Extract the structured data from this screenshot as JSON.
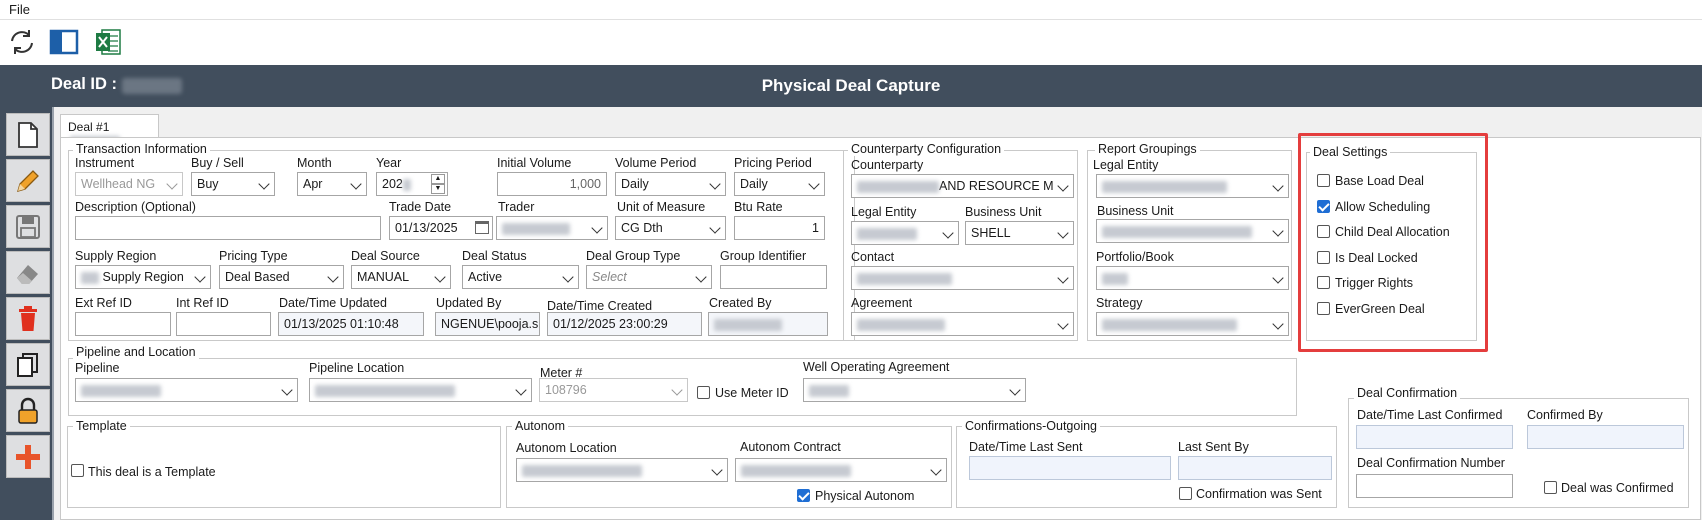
{
  "menu": {
    "file": "File"
  },
  "toolbar": {
    "icons": [
      "refresh-icon",
      "panel-layout-icon",
      "excel-icon"
    ]
  },
  "header": {
    "deal_id_label": "Deal ID :",
    "title": "Physical Deal Capture"
  },
  "sidebar": {
    "icons": [
      "new-document-icon",
      "edit-pencil-icon",
      "save-icon",
      "eraser-icon",
      "delete-trash-icon",
      "copy-icon",
      "lock-icon",
      "add-plus-icon"
    ]
  },
  "tab": {
    "label": "Deal #1"
  },
  "transaction": {
    "title": "Transaction Information",
    "instrument_label": "Instrument",
    "instrument_value": "Wellhead NG",
    "buysell_label": "Buy / Sell",
    "buysell_value": "Buy",
    "month_label": "Month",
    "month_value": "Apr",
    "year_label": "Year",
    "year_value": "202",
    "initial_volume_label": "Initial Volume",
    "initial_volume_value": "1,000",
    "volume_period_label": "Volume Period",
    "volume_period_value": "Daily",
    "pricing_period_label": "Pricing Period",
    "pricing_period_value": "Daily",
    "description_label": "Description (Optional)",
    "trade_date_label": "Trade Date",
    "trade_date_value": "01/13/2025",
    "trader_label": "Trader",
    "uom_label": "Unit of Measure",
    "uom_value": "CG Dth",
    "btu_label": "Btu Rate",
    "btu_value": "1",
    "supply_region_label": "Supply Region",
    "supply_region_value": "Supply Region",
    "pricing_type_label": "Pricing Type",
    "pricing_type_value": "Deal Based",
    "deal_source_label": "Deal Source",
    "deal_source_value": "MANUAL",
    "deal_status_label": "Deal Status",
    "deal_status_value": "Active",
    "deal_group_type_label": "Deal Group Type",
    "deal_group_type_placeholder": "Select",
    "group_identifier_label": "Group Identifier",
    "ext_ref_label": "Ext Ref ID",
    "int_ref_label": "Int Ref ID",
    "updated_dt_label": "Date/Time Updated",
    "updated_dt_value": "01/13/2025 01:10:48",
    "updated_by_label": "Updated By",
    "updated_by_value": "NGENUE\\pooja.s",
    "created_dt_label": "Date/Time Created",
    "created_dt_value": "01/12/2025 23:00:29",
    "created_by_label": "Created By"
  },
  "counterparty": {
    "title": "Counterparty Configuration",
    "counterparty_label": "Counterparty",
    "counterparty_value": "AND RESOURCE M",
    "legal_entity_label": "Legal Entity",
    "business_unit_label": "Business Unit",
    "business_unit_value": "SHELL",
    "contact_label": "Contact",
    "agreement_label": "Agreement"
  },
  "report": {
    "title": "Report Groupings",
    "legal_entity_label": "Legal Entity",
    "business_unit_label": "Business Unit",
    "portfolio_label": "Portfolio/Book",
    "strategy_label": "Strategy"
  },
  "settings": {
    "title": "Deal Settings",
    "items": [
      {
        "label": "Base Load Deal",
        "checked": false
      },
      {
        "label": "Allow Scheduling",
        "checked": true
      },
      {
        "label": "Child Deal Allocation",
        "checked": false
      },
      {
        "label": "Is Deal Locked",
        "checked": false
      },
      {
        "label": "Trigger Rights",
        "checked": false
      },
      {
        "label": "EverGreen Deal",
        "checked": false
      }
    ]
  },
  "pipeline": {
    "title": "Pipeline and Location",
    "pipeline_label": "Pipeline",
    "location_label": "Pipeline Location",
    "meter_label": "Meter #",
    "meter_value": "108796",
    "use_meter_label": "Use Meter ID",
    "woa_label": "Well Operating Agreement"
  },
  "template": {
    "title": "Template",
    "checkbox_label": "This deal is a Template"
  },
  "autonom": {
    "title": "Autonom",
    "location_label": "Autonom Location",
    "contract_label": "Autonom Contract",
    "physical_label": "Physical Autonom"
  },
  "confout": {
    "title": "Confirmations-Outgoing",
    "last_sent_label": "Date/Time Last Sent",
    "sent_by_label": "Last Sent By",
    "was_sent_label": "Confirmation was Sent"
  },
  "dealconf": {
    "title": "Deal Confirmation",
    "last_confirmed_label": "Date/Time Last Confirmed",
    "confirmed_by_label": "Confirmed By",
    "number_label": "Deal Confirmation Number",
    "was_confirmed_label": "Deal was Confirmed"
  },
  "colors": {
    "header_bg": "#414e5d",
    "highlight": "#e43d3d",
    "check_blue": "#1f6ed4",
    "delete_red": "#e0301e",
    "pencil_orange": "#f0a22a",
    "lock_orange": "#f0a22a",
    "excel_green": "#1e7b43"
  }
}
